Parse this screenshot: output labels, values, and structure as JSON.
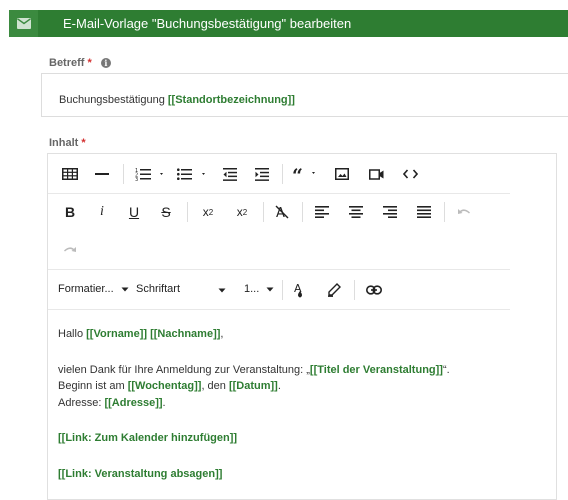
{
  "window": {
    "title": "E-Mail-Vorlage \"Buchungsbestätigung\" bearbeiten",
    "header_color": "#2e7d32"
  },
  "subject": {
    "label": "Betreff",
    "required_mark": "*",
    "info_icon": "info-icon",
    "value_prefix": "Buchungsbestätigung ",
    "value_placeholder": "[[Standortbezeichnung]]"
  },
  "content": {
    "label": "Inhalt",
    "required_mark": "*",
    "toolbar": {
      "row1": [
        "table-icon",
        "horizontal-line-icon",
        "numbered-list-icon",
        "bulleted-list-icon",
        "outdent-icon",
        "indent-icon",
        "blockquote-icon",
        "image-icon",
        "video-icon",
        "code-view-icon"
      ],
      "row2": [
        "bold-icon",
        "italic-icon",
        "underline-icon",
        "strikethrough-icon",
        "subscript-icon",
        "superscript-icon",
        "clear-format-icon",
        "align-left-icon",
        "align-center-icon",
        "align-right-icon",
        "justify-icon",
        "undo-icon"
      ],
      "row3": [
        "redo-icon"
      ],
      "row4": [
        "text-color-icon",
        "highlight-icon",
        "link-icon"
      ],
      "format_select": "Formatier...",
      "font_select": "Schriftart",
      "size_select": "1..."
    },
    "body": {
      "greeting_prefix": "Hallo ",
      "vorname": "[[Vorname]]",
      "nachname": "[[Nachname]]",
      "greeting_suffix": ",",
      "line1_prefix": "vielen Dank für Ihre Anmeldung zur Veranstaltung: „",
      "titel": "[[Titel der Veranstaltung]]",
      "line1_suffix": "“.",
      "line2_prefix": "Beginn ist am ",
      "wochentag": "[[Wochentag]]",
      "line2_mid": ", den ",
      "datum": "[[Datum]]",
      "line2_suffix": ".",
      "line3_prefix": "Adresse: ",
      "adresse": "[[Adresse]]",
      "line3_suffix": ".",
      "link_calendar": "[[Link: Zum Kalender hinzufügen]]",
      "link_cancel": "[[Link: Veranstaltung absagen]]"
    }
  }
}
